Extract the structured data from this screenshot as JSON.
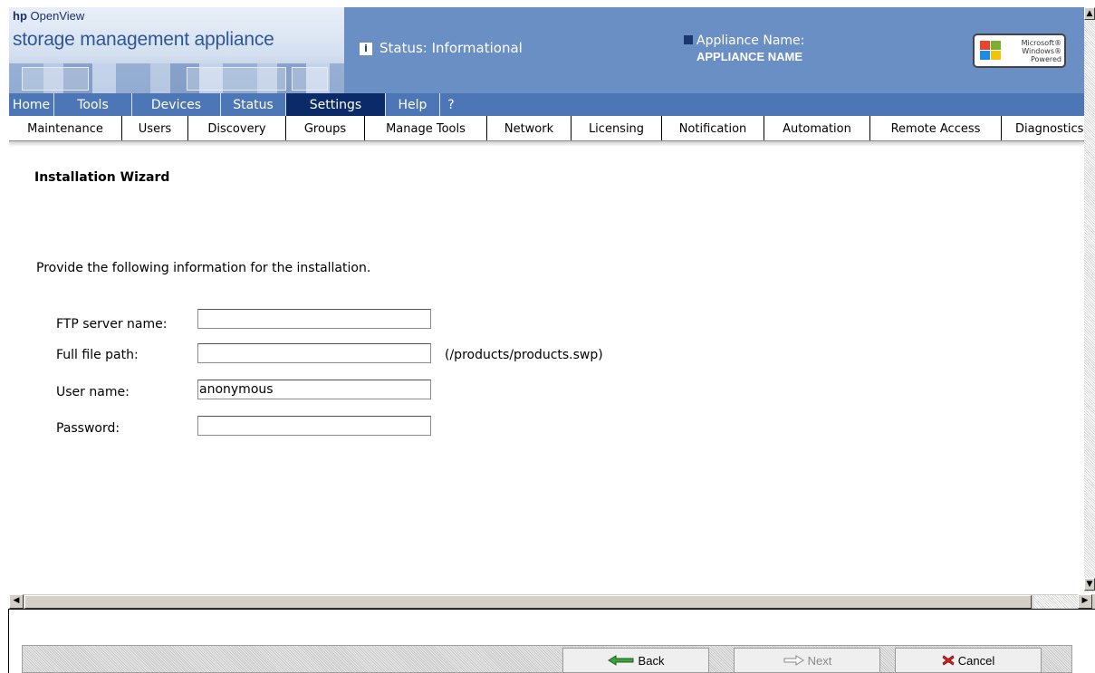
{
  "header": {
    "brand_line1_bold": "hp",
    "brand_line1": " OpenView",
    "brand_line2": "storage management appliance",
    "status_icon": "i",
    "status_text": "Status: Informational",
    "appliance_label": "Appliance Name:",
    "appliance_value": "APPLIANCE NAME",
    "windows_badge": [
      "Microsoft®",
      "Windows®",
      "Powered"
    ]
  },
  "topnav": [
    {
      "label": "Home",
      "active": false
    },
    {
      "label": "Tools",
      "active": false
    },
    {
      "label": "Devices",
      "active": false
    },
    {
      "label": "Status",
      "active": false
    },
    {
      "label": "Settings",
      "active": true
    },
    {
      "label": "Help",
      "active": false
    },
    {
      "label": "?",
      "active": false
    }
  ],
  "subnav": [
    {
      "label": "Maintenance",
      "active": true
    },
    {
      "label": "Users"
    },
    {
      "label": "Discovery"
    },
    {
      "label": "Groups"
    },
    {
      "label": "Manage Tools"
    },
    {
      "label": "Network"
    },
    {
      "label": "Licensing"
    },
    {
      "label": "Notification"
    },
    {
      "label": "Automation"
    },
    {
      "label": "Remote Access"
    },
    {
      "label": "Diagnostics"
    }
  ],
  "main": {
    "title": "Installation Wizard",
    "intro": "Provide the following information for the installation.",
    "form": {
      "ftp_label": "FTP server name:",
      "ftp_value": "",
      "path_label": "Full file path:",
      "path_value": "",
      "path_hint": "(/products/products.swp)",
      "user_label": "User name:",
      "user_value": "anonymous",
      "password_label": "Password:",
      "password_value": ""
    }
  },
  "buttons": {
    "back": "Back",
    "next": "Next",
    "cancel": "Cancel"
  },
  "colors": {
    "banner": "#6a8fc4",
    "nav": "#4c76b6",
    "nav_active": "#0a2a68"
  }
}
